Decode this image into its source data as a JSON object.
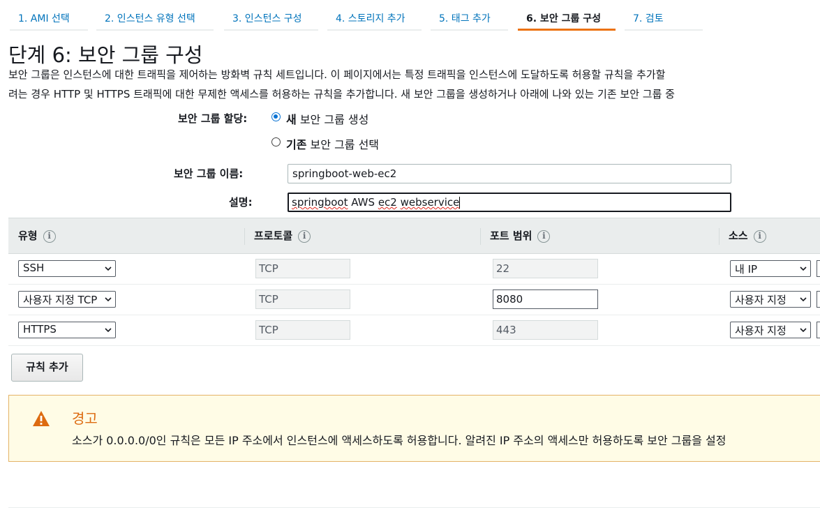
{
  "wizard": {
    "steps": [
      {
        "label": "1. AMI 선택"
      },
      {
        "label": "2. 인스턴스 유형 선택"
      },
      {
        "label": "3. 인스턴스 구성"
      },
      {
        "label": "4. 스토리지 추가"
      },
      {
        "label": "5. 태그 추가"
      },
      {
        "label": "6. 보안 그룹 구성",
        "active": true
      },
      {
        "label": "7. 검토"
      }
    ]
  },
  "page": {
    "title": "단계 6: 보안 그룹 구성",
    "description_line1": "보안 그룹은 인스턴스에 대한 트래픽을 제어하는 방화벽 규칙 세트입니다. 이 페이지에서는 특정 트래픽을 인스턴스에 도달하도록 허용할 규칙을 추가할",
    "description_line2": "려는 경우 HTTP 및 HTTPS 트래픽에 대한 무제한 액세스를 허용하는 규칙을 추가합니다. 새 보안 그룹을 생성하거나 아래에 나와 있는 기존 보안 그룹 중"
  },
  "form": {
    "assign_label": "보안 그룹 할당:",
    "option_new_bold": "새",
    "option_new_rest": " 보안 그룹 생성",
    "option_existing_bold": "기존",
    "option_existing_rest": " 보안 그룹 선택",
    "name_label": "보안 그룹 이름:",
    "name_value": "springboot-web-ec2",
    "desc_label": "설명:",
    "desc_word1": "springboot",
    "desc_word2": " AWS ",
    "desc_word3": "ec2",
    "desc_word4": " ",
    "desc_word5": "webservice"
  },
  "table": {
    "headers": {
      "type": "유형",
      "protocol": "프로토콜",
      "port_range": "포트 범위",
      "source": "소스"
    },
    "rows": [
      {
        "type": "SSH",
        "protocol": "TCP",
        "port": "22",
        "source": "내 IP"
      },
      {
        "type": "사용자 지정 TCP",
        "protocol": "TCP",
        "port": "8080",
        "source": "사용자 지정"
      },
      {
        "type": "HTTPS",
        "protocol": "TCP",
        "port": "443",
        "source": "사용자 지정"
      }
    ],
    "info_glyph": "i"
  },
  "add_rule_label": "규칙 추가",
  "warning": {
    "title": "경고",
    "text": "소스가 0.0.0.0/0인 규칙은 모든 IP 주소에서 인스턴스에 액세스하도록 허용합니다. 알려진 IP 주소의 액세스만 허용하도록 보안 그룹을 설정"
  },
  "colors": {
    "link": "#0073bb",
    "active_tab": "#ec7211",
    "warning_icon": "#dd6b10",
    "radio_selected": "#0972d3"
  }
}
